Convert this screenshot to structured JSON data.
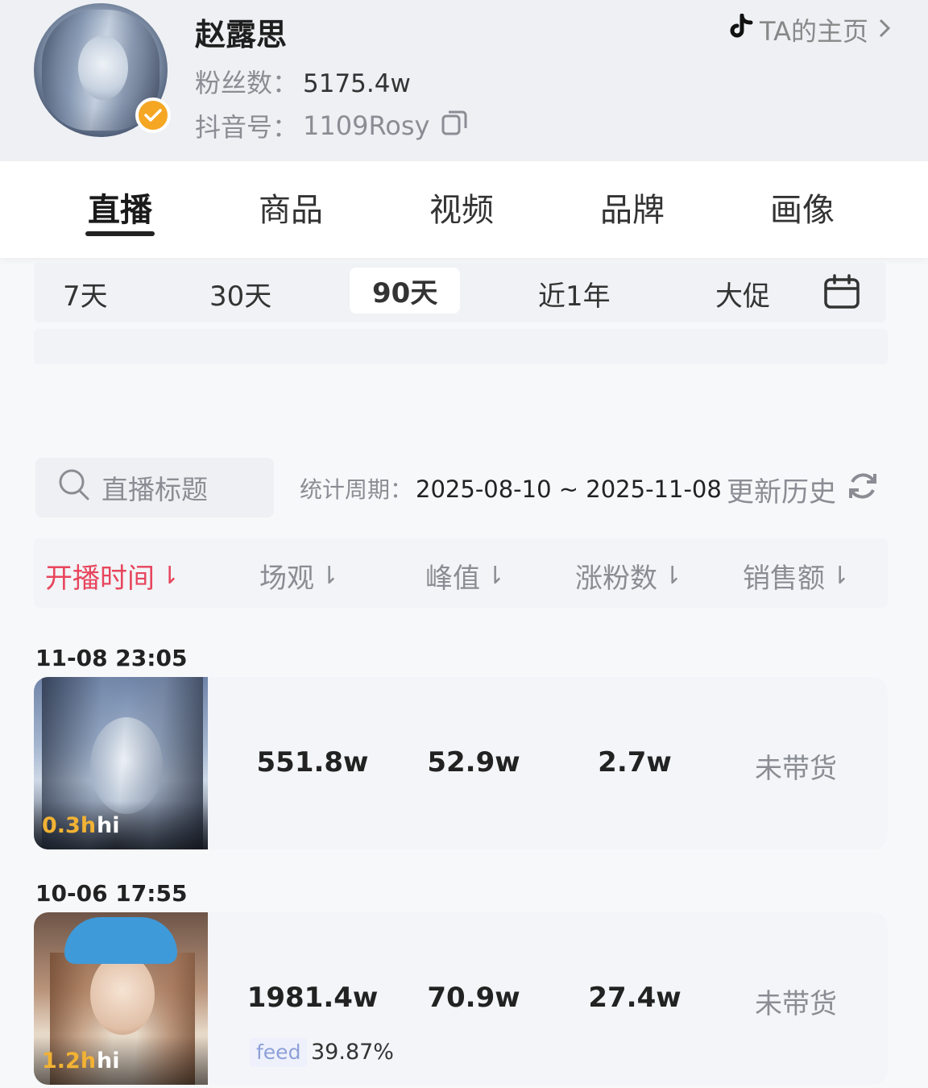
{
  "profile": {
    "name": "赵露思",
    "fans_label": "粉丝数：",
    "fans_value": "5175.4w",
    "id_label": "抖音号：",
    "id_value": "1109Rosy",
    "home_link": "TA的主页",
    "verified_color": "#f5a623"
  },
  "tabs": [
    "直播",
    "商品",
    "视频",
    "品牌",
    "画像"
  ],
  "active_tab": "直播",
  "periods": [
    "7天",
    "30天",
    "90天",
    "近1年",
    "大促"
  ],
  "active_period": "90天",
  "search": {
    "placeholder": "直播标题"
  },
  "stat_period": {
    "label": "统计周期：",
    "range": "2025-08-10 ~ 2025-11-08"
  },
  "update_history": "更新历史",
  "sort_columns": [
    "开播时间",
    "场观",
    "峰值",
    "涨粉数",
    "销售额"
  ],
  "active_sort": "开播时间",
  "accent_color": "#e8455d",
  "records": [
    {
      "time": "11-08 23:05",
      "duration": "0.3h",
      "tag": "hi",
      "views": "551.8w",
      "peak": "52.9w",
      "new_fans": "2.7w",
      "sales": "未带货"
    },
    {
      "time": "10-06 17:55",
      "duration": "1.2h",
      "tag": "hi",
      "views": "1981.4w",
      "peak": "70.9w",
      "new_fans": "27.4w",
      "sales": "未带货",
      "feed_label": "feed",
      "feed_pct": "39.87%"
    }
  ]
}
